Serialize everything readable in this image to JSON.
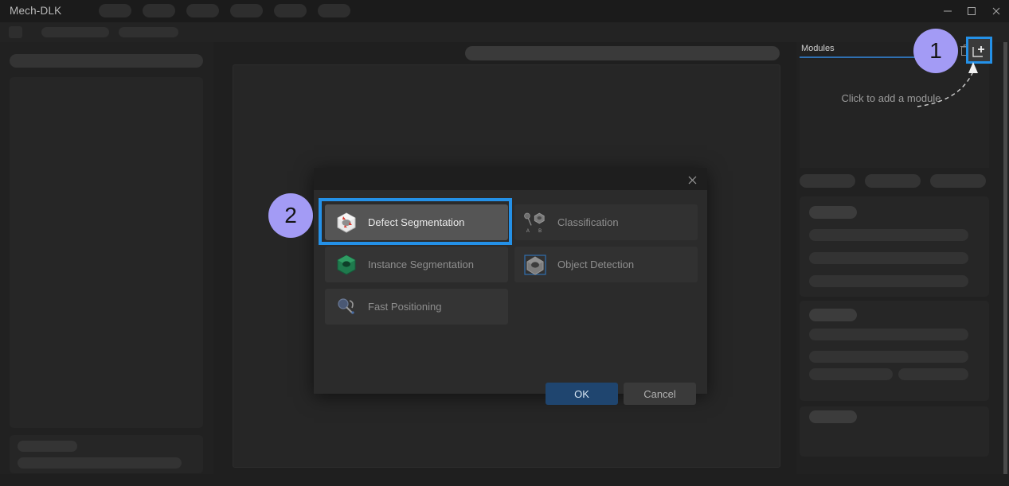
{
  "window": {
    "app_title": "Mech-DLK",
    "controls": [
      {
        "name": "minimize",
        "glyph": "minimize-icon"
      },
      {
        "name": "maximize",
        "glyph": "maximize-icon"
      },
      {
        "name": "close",
        "glyph": "close-icon"
      }
    ]
  },
  "right_panel": {
    "tab_label": "Modules",
    "empty_hint": "Click to add a module",
    "add_button_icon": "add-module-plus-icon",
    "delete_button_icon": "trash-icon",
    "accent_color": "#2491e8",
    "tab_underline_color": "#2f6fb0"
  },
  "dialog": {
    "close_icon": "close-icon",
    "modules_left": [
      {
        "label": "Defect Segmentation",
        "icon": "defect-segmentation-icon",
        "selected": true,
        "enabled": true
      },
      {
        "label": "Instance Segmentation",
        "icon": "instance-segmentation-icon",
        "selected": false,
        "enabled": false
      },
      {
        "label": "Fast Positioning",
        "icon": "fast-positioning-icon",
        "selected": false,
        "enabled": false
      }
    ],
    "modules_right": [
      {
        "label": "Classification",
        "icon": "classification-icon",
        "selected": false,
        "enabled": false
      },
      {
        "label": "Object Detection",
        "icon": "object-detection-icon",
        "selected": false,
        "enabled": false
      }
    ],
    "ok_label": "OK",
    "cancel_label": "Cancel",
    "ok_color": "#1f456f",
    "selection_outline_color": "#2491e8"
  },
  "callouts": {
    "badge_color": "#a39bf5",
    "step_one": "1",
    "step_two": "2"
  }
}
